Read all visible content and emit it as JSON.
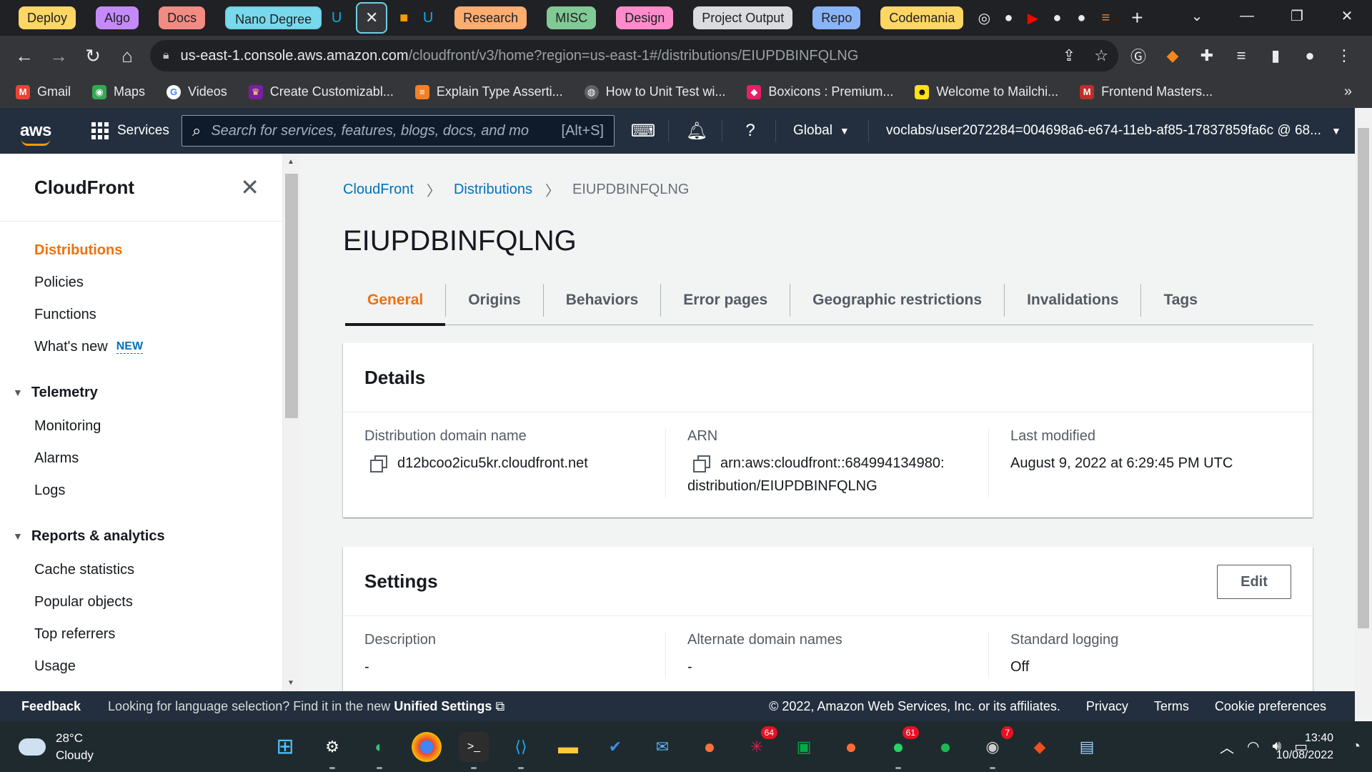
{
  "browser": {
    "tab_groups": [
      {
        "label": "Deploy",
        "color": "#fdd663"
      },
      {
        "label": "Algo",
        "color": "#c58af9"
      },
      {
        "label": "Docs",
        "color": "#f28b82"
      },
      {
        "label": "Nano Degree",
        "color": "#78d9ec"
      },
      {
        "label": "Research",
        "color": "#fcad70"
      },
      {
        "label": "MISC",
        "color": "#81c995"
      },
      {
        "label": "Design",
        "color": "#ff8bcb"
      },
      {
        "label": "Project Output",
        "color": "#dadce0"
      },
      {
        "label": "Repo",
        "color": "#8ab4f8"
      },
      {
        "label": "Codemania",
        "color": "#fdd663"
      }
    ],
    "url_host": "us-east-1.console.aws.amazon.com",
    "url_path": "/cloudfront/v3/home?region=us-east-1#/distributions/EIUPDBINFQLNG",
    "bookmarks": [
      {
        "label": "Gmail",
        "icon": "gmail-icon",
        "color": "#ea4335"
      },
      {
        "label": "Maps",
        "icon": "maps-icon",
        "color": "#34a853"
      },
      {
        "label": "Videos",
        "icon": "google-icon",
        "color": "#4285f4"
      },
      {
        "label": "Create Customizabl...",
        "icon": "crown-icon",
        "color": "#7b1fa2"
      },
      {
        "label": "Explain Type Asserti...",
        "icon": "stack-icon",
        "color": "#f48024"
      },
      {
        "label": "How to Unit Test wi...",
        "icon": "globe-icon",
        "color": "#5f6368"
      },
      {
        "label": "Boxicons : Premium...",
        "icon": "boxicons-icon",
        "color": "#e91e63"
      },
      {
        "label": "Welcome to Mailchi...",
        "icon": "mailchimp-icon",
        "color": "#ffe01b"
      },
      {
        "label": "Frontend Masters...",
        "icon": "frontend-masters-icon",
        "color": "#c02d28"
      }
    ]
  },
  "aws": {
    "services_label": "Services",
    "search_placeholder": "Search for services, features, blogs, docs, and mo",
    "search_hint": "[Alt+S]",
    "region": "Global",
    "account": "voclabs/user2072284=004698a6-e674-11eb-af85-17837859fa6c @ 68..."
  },
  "sidebar": {
    "title": "CloudFront",
    "items": [
      {
        "label": "Distributions",
        "active": true
      },
      {
        "label": "Policies"
      },
      {
        "label": "Functions"
      },
      {
        "label": "What's new",
        "badge": "NEW"
      }
    ],
    "telemetry": {
      "title": "Telemetry",
      "items": [
        "Monitoring",
        "Alarms",
        "Logs"
      ]
    },
    "reports": {
      "title": "Reports & analytics",
      "items": [
        "Cache statistics",
        "Popular objects",
        "Top referrers",
        "Usage"
      ]
    }
  },
  "main": {
    "breadcrumbs": [
      "CloudFront",
      "Distributions",
      "EIUPDBINFQLNG"
    ],
    "title": "EIUPDBINFQLNG",
    "tabs": [
      "General",
      "Origins",
      "Behaviors",
      "Error pages",
      "Geographic restrictions",
      "Invalidations",
      "Tags"
    ],
    "details": {
      "title": "Details",
      "domain_label": "Distribution domain name",
      "domain_value": "d12bcoo2icu5kr.cloudfront.net",
      "arn_label": "ARN",
      "arn_line1": "arn:aws:cloudfront::684994134980:",
      "arn_line2": "distribution/EIUPDBINFQLNG",
      "modified_label": "Last modified",
      "modified_value": "August 9, 2022 at 6:29:45 PM UTC"
    },
    "settings": {
      "title": "Settings",
      "edit_label": "Edit",
      "description_label": "Description",
      "description_value": "-",
      "alt_domains_label": "Alternate domain names",
      "alt_domains_value": "-",
      "logging_label": "Standard logging",
      "logging_value": "Off"
    }
  },
  "footer": {
    "feedback": "Feedback",
    "lang_text": "Looking for language selection? Find it in the new",
    "lang_link": "Unified Settings",
    "copyright": "© 2022, Amazon Web Services, Inc. or its affiliates.",
    "privacy": "Privacy",
    "terms": "Terms",
    "cookies": "Cookie preferences"
  },
  "taskbar": {
    "temp": "28°C",
    "condition": "Cloudy",
    "time": "13:40",
    "date": "10/08/2022",
    "badges": {
      "slack": "64",
      "whatsapp": "61",
      "app": "7"
    }
  }
}
